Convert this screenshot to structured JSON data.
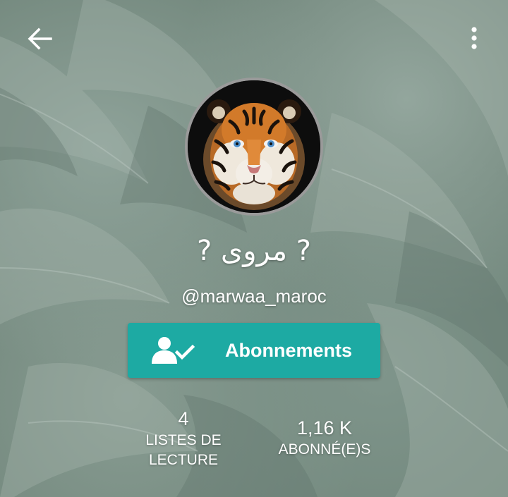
{
  "header": {
    "back_icon": "arrow-left-icon",
    "menu_icon": "more-vertical-icon"
  },
  "profile": {
    "avatar_icon": "tiger-avatar",
    "display_name": "? مروى ?",
    "username": "@marwaa_maroc"
  },
  "follow_button": {
    "label": "Abonnements",
    "icon": "user-check-icon",
    "color": "#1daaa3"
  },
  "stats": {
    "reading_lists": {
      "value": "4",
      "label": "LISTES DE LECTURE"
    },
    "followers": {
      "value": "1,16 K",
      "label": "ABONNÉ(E)S"
    }
  }
}
